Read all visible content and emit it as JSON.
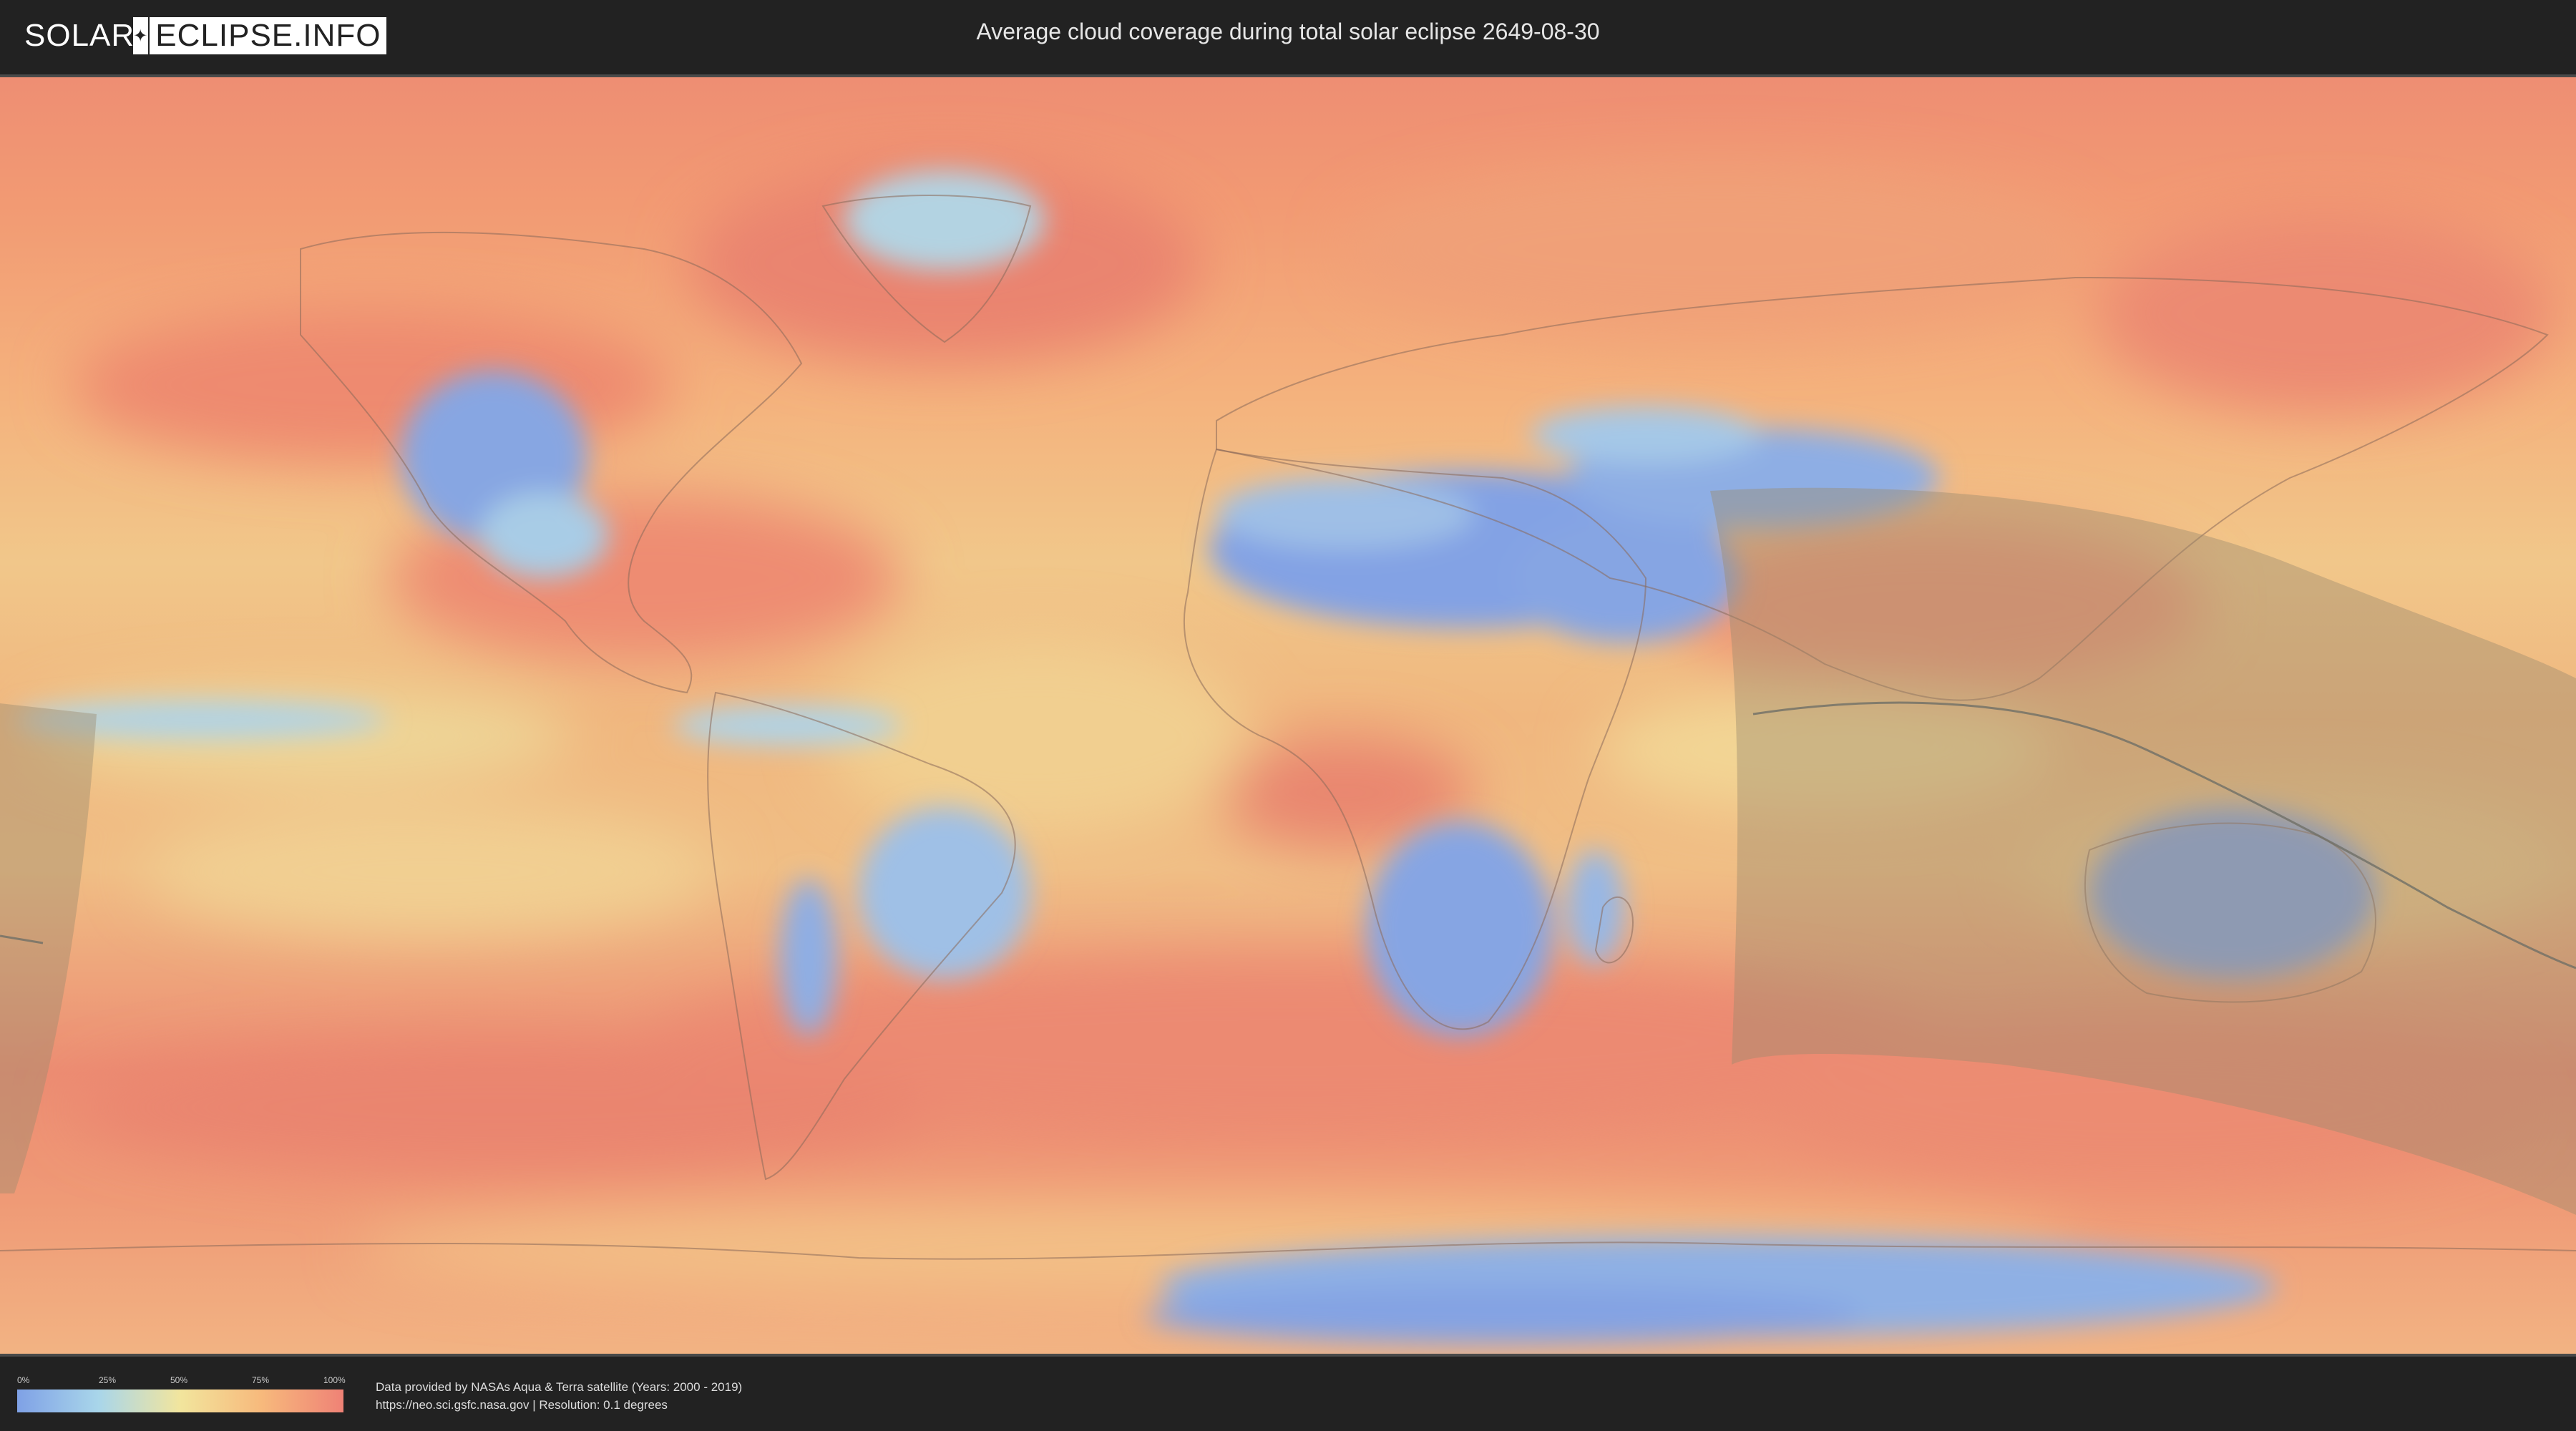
{
  "header": {
    "logo_left": "SOLAR",
    "logo_right": "ECLIPSE.INFO",
    "title": "Average cloud coverage during total solar eclipse 2649-08-30"
  },
  "legend": {
    "labels": [
      "0%",
      "25%",
      "50%",
      "75%",
      "100%"
    ],
    "colors": [
      "#7fa1e6",
      "#a9d6ea",
      "#f2e59d",
      "#f7b97c",
      "#ef8276"
    ]
  },
  "credits": {
    "line1": "Data provided by NASAs Aqua & Terra satellite (Years: 2000 - 2019)",
    "line2": "https://neo.sci.gsfc.nasa.gov | Resolution: 0.1 degrees"
  },
  "map": {
    "projection": "equirectangular",
    "layers": [
      "cloud-coverage-raster",
      "country-borders",
      "eclipse-visibility-shading",
      "totality-path-line"
    ]
  }
}
